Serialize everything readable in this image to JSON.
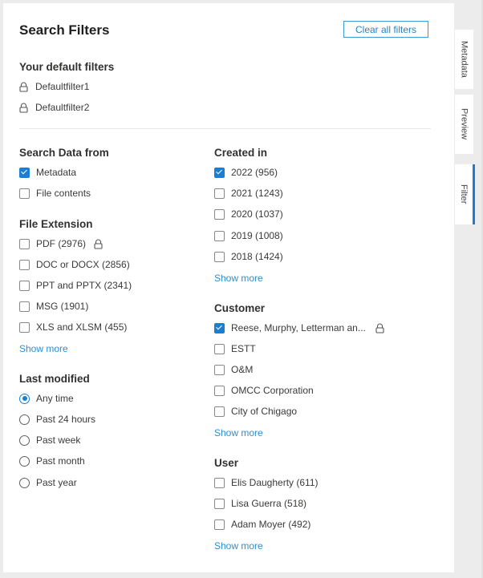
{
  "header": {
    "title": "Search Filters",
    "clear_all_label": "Clear all filters"
  },
  "default_filters": {
    "title": "Your default filters",
    "items": [
      {
        "label": "Defaultfilter1",
        "icon": "lock-icon"
      },
      {
        "label": "Defaultfilter2",
        "icon": "lock-icon"
      }
    ]
  },
  "search_data_from": {
    "title": "Search Data from",
    "items": [
      {
        "label": "Metadata",
        "checked": true
      },
      {
        "label": "File contents",
        "checked": false
      }
    ]
  },
  "file_extension": {
    "title": "File Extension",
    "items": [
      {
        "label": "PDF (2976)",
        "checked": false,
        "locked": true
      },
      {
        "label": "DOC or DOCX (2856)",
        "checked": false
      },
      {
        "label": "PPT and PPTX (2341)",
        "checked": false
      },
      {
        "label": "MSG (1901)",
        "checked": false
      },
      {
        "label": "XLS and XLSM (455)",
        "checked": false
      }
    ],
    "show_more": "Show more"
  },
  "last_modified": {
    "title": "Last modified",
    "options": [
      {
        "label": "Any time",
        "selected": true
      },
      {
        "label": "Past 24 hours",
        "selected": false
      },
      {
        "label": "Past week",
        "selected": false
      },
      {
        "label": "Past month",
        "selected": false
      },
      {
        "label": "Past year",
        "selected": false
      }
    ]
  },
  "created_in": {
    "title": "Created in",
    "items": [
      {
        "label": "2022 (956)",
        "checked": true
      },
      {
        "label": "2021 (1243)",
        "checked": false
      },
      {
        "label": "2020 (1037)",
        "checked": false
      },
      {
        "label": "2019 (1008)",
        "checked": false
      },
      {
        "label": "2018 (1424)",
        "checked": false
      }
    ],
    "show_more": "Show more"
  },
  "customer": {
    "title": "Customer",
    "items": [
      {
        "label": "Reese, Murphy, Letterman an...",
        "checked": true,
        "locked": true
      },
      {
        "label": "ESTT",
        "checked": false
      },
      {
        "label": "O&M",
        "checked": false
      },
      {
        "label": "OMCC Corporation",
        "checked": false
      },
      {
        "label": "City of Chigago",
        "checked": false
      }
    ],
    "show_more": "Show more"
  },
  "user": {
    "title": "User",
    "items": [
      {
        "label": "Elis Daugherty (611)",
        "checked": false
      },
      {
        "label": "Lisa Guerra (518)",
        "checked": false
      },
      {
        "label": "Adam Moyer (492)",
        "checked": false
      }
    ],
    "show_more": "Show more"
  },
  "side_tabs": [
    {
      "label": "Metadata",
      "active": false
    },
    {
      "label": "Preview",
      "active": false
    },
    {
      "label": "Filter",
      "active": true
    }
  ],
  "colors": {
    "accent": "#1a7fd4",
    "link": "#2b8fd0",
    "background": "#ececec",
    "panel": "#ffffff"
  }
}
